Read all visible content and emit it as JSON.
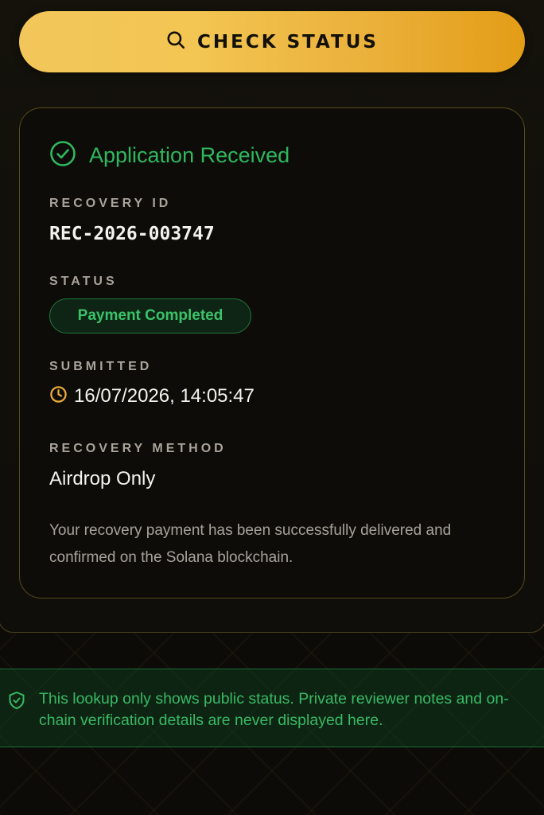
{
  "check_button": {
    "label": "CHECK STATUS",
    "icon": "search-icon"
  },
  "result": {
    "header": "Application Received",
    "header_icon": "check-circle-icon",
    "recovery_id_label": "RECOVERY ID",
    "recovery_id": "REC-2026-003747",
    "status_label": "STATUS",
    "status_value": "Payment Completed",
    "submitted_label": "SUBMITTED",
    "submitted_value": "16/07/2026, 14:05:47",
    "submitted_icon": "clock-icon",
    "method_label": "RECOVERY METHOD",
    "method_value": "Airdrop Only",
    "description": "Your recovery payment has been successfully delivered and confirmed on the Solana blockchain."
  },
  "notice": {
    "icon": "shield-check-icon",
    "text": "This lookup only shows public status. Private reviewer notes and on-chain verification details are never displayed here."
  },
  "colors": {
    "accent_gold": "#f2c65a",
    "success_green": "#2fb85e",
    "background": "#0c0b07"
  }
}
